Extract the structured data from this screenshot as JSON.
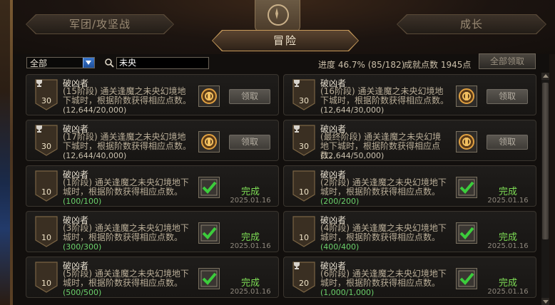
{
  "tabs": {
    "left": "军团/攻坚战",
    "active": "冒险",
    "right": "成长"
  },
  "filter": {
    "selected": "全部",
    "search_value": "未央"
  },
  "summary": {
    "progress": "进度 46.7% (85/182)",
    "points": "成就点数 1945点",
    "claim_all": "全部领取"
  },
  "achievements": [
    {
      "title": "破凶者",
      "desc": "(15阶段) 通关逢魔之未央幻境地下城时，根据阶数获得相应点数。",
      "progress": "(12,644/20,000)",
      "points": "30",
      "trophy": true,
      "done": false,
      "button": "领取",
      "status": "",
      "date": ""
    },
    {
      "title": "破凶者",
      "desc": "(16阶段) 通关逢魔之未央幻境地下城时，根据阶数获得相应点数。",
      "progress": "(12,644/30,000)",
      "points": "30",
      "trophy": true,
      "done": false,
      "button": "领取",
      "status": "",
      "date": ""
    },
    {
      "title": "破凶者",
      "desc": "(17阶段) 通关逢魔之未央幻境地下城时，根据阶数获得相应点数。",
      "progress": "(12,644/40,000)",
      "points": "30",
      "trophy": true,
      "done": false,
      "button": "领取",
      "status": "",
      "date": ""
    },
    {
      "title": "破凶者",
      "desc": "(最终阶段) 通关逢魔之未央幻境地下城时，根据阶数获得相应点数。",
      "progress": "(12,644/50,000)",
      "points": "30",
      "trophy": true,
      "done": false,
      "button": "领取",
      "status": "",
      "date": ""
    },
    {
      "title": "破凶者",
      "desc": "(1阶段) 通关逢魔之未央幻境地下城时，根据阶数获得相应点数。",
      "progress": "(100/100)",
      "points": "10",
      "trophy": false,
      "done": true,
      "button": "",
      "status": "完成",
      "date": "2025.01.16"
    },
    {
      "title": "破凶者",
      "desc": "(2阶段) 通关逢魔之未央幻境地下城时，根据阶数获得相应点数。",
      "progress": "(200/200)",
      "points": "10",
      "trophy": false,
      "done": true,
      "button": "",
      "status": "完成",
      "date": "2025.01.16"
    },
    {
      "title": "破凶者",
      "desc": "(3阶段) 通关逢魔之未央幻境地下城时，根据阶数获得相应点数。",
      "progress": "(300/300)",
      "points": "10",
      "trophy": false,
      "done": true,
      "button": "",
      "status": "完成",
      "date": "2025.01.16"
    },
    {
      "title": "破凶者",
      "desc": "(4阶段) 通关逢魔之未央幻境地下城时，根据阶数获得相应点数。",
      "progress": "(400/400)",
      "points": "10",
      "trophy": false,
      "done": true,
      "button": "",
      "status": "完成",
      "date": "2025.01.16"
    },
    {
      "title": "破凶者",
      "desc": "(5阶段) 通关逢魔之未央幻境地下城时，根据阶数获得相应点数。",
      "progress": "(500/500)",
      "points": "10",
      "trophy": false,
      "done": true,
      "button": "",
      "status": "完成",
      "date": "2025.01.16"
    },
    {
      "title": "破凶者",
      "desc": "(6阶段) 通关逢魔之未央幻境地下城时，根据阶数获得相应点数。",
      "progress": "(1,000/1,000)",
      "points": "20",
      "trophy": true,
      "done": true,
      "button": "",
      "status": "完成",
      "date": "2025.01.16"
    }
  ],
  "icons": {
    "search": "search-icon",
    "dropdown": "chevron-down-icon",
    "trophy": "trophy-icon",
    "reward_unclaimed": "medal-icon",
    "reward_claimed": "check-icon",
    "emblem": "compass-icon"
  },
  "colors": {
    "accent_gold": "#c69a5a",
    "done_green": "#7ddc55",
    "progress_done": "#6bd06b"
  }
}
